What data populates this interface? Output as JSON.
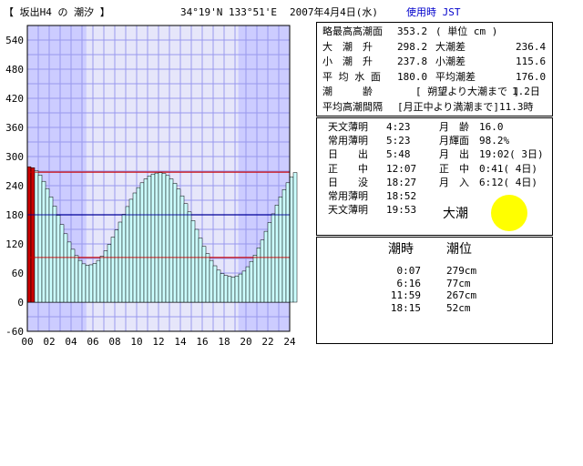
{
  "header": {
    "location": "【 坂出H4 の 潮汐 】",
    "coords": "34°19'N  133°51'E",
    "date": "2007年4月4日(水)",
    "timezone": "使用時 JST"
  },
  "info": {
    "rows": [
      [
        "略最高高潮面",
        "353.2",
        "( 単位 cm )",
        ""
      ],
      [
        "大　潮　升",
        "298.2",
        "大潮差",
        "236.4"
      ],
      [
        "小　潮　升",
        "237.8",
        "小潮差",
        "115.6"
      ],
      [
        "平 均 水 面",
        "180.0",
        "平均潮差",
        "176.0"
      ],
      [
        "潮　　　齢",
        "[ 朔望より大潮まで ]",
        "",
        "1.2日"
      ],
      [
        "平均高潮間隔",
        "[月正中より満潮まで]",
        "",
        "11.3時"
      ]
    ]
  },
  "astro": {
    "left": [
      [
        "天文薄明",
        "4:23"
      ],
      [
        "常用薄明",
        "5:23"
      ],
      [
        "日　　出",
        "5:48"
      ],
      [
        "正　　中",
        "12:07"
      ],
      [
        "日　　没",
        "18:27"
      ],
      [
        "常用薄明",
        "18:52"
      ],
      [
        "天文薄明",
        "19:53"
      ]
    ],
    "right": [
      [
        "月　齢",
        "16.0"
      ],
      [
        "月輝面",
        "98.2%"
      ],
      [
        "月　出",
        "19:02( 3日)"
      ],
      [
        "正　中",
        "0:41( 4日)"
      ],
      [
        "月　入",
        "6:12( 4日)"
      ]
    ],
    "tide_type": "大潮"
  },
  "tides": {
    "header_time": "潮時",
    "header_level": "潮位",
    "events": [
      [
        "0:07",
        "279cm"
      ],
      [
        "6:16",
        "77cm"
      ],
      [
        "11:59",
        "267cm"
      ],
      [
        "18:15",
        "52cm"
      ]
    ]
  },
  "colors": {
    "plot_bg": "#e6e6fa",
    "night_band": "#ccccff",
    "bar_fill": "#ccffff",
    "current_bar": "#cc0000",
    "upper_line": "#cc0000",
    "mean_line": "#000099",
    "lower_line": "#cc0000",
    "moon": "#ffff00"
  },
  "chart_data": {
    "type": "bar",
    "xlim": [
      0,
      24
    ],
    "ylim": [
      -60,
      570
    ],
    "xticks": [
      "00",
      "02",
      "04",
      "06",
      "08",
      "10",
      "12",
      "14",
      "16",
      "18",
      "20",
      "22",
      "24"
    ],
    "yticks": [
      "-60",
      "0",
      "60",
      "120",
      "180",
      "240",
      "300",
      "360",
      "420",
      "480",
      "540"
    ],
    "ytick_values": [
      -60,
      0,
      60,
      120,
      180,
      240,
      300,
      360,
      420,
      480,
      540
    ],
    "night_periods": [
      [
        0,
        5.4
      ],
      [
        19.3,
        24
      ]
    ],
    "reference_lines": [
      {
        "value": 268,
        "color": "#cc0000"
      },
      {
        "value": 180,
        "color": "#000099"
      },
      {
        "value": 92,
        "color": "#cc0000"
      }
    ],
    "current_bars": [
      0,
      1
    ],
    "interval_minutes": 20,
    "values": [
      279,
      277,
      271,
      262,
      249,
      234,
      217,
      198,
      179,
      160,
      141,
      124,
      109,
      96,
      86,
      79,
      76,
      77,
      80,
      86,
      95,
      106,
      119,
      134,
      149,
      165,
      181,
      197,
      212,
      225,
      236,
      246,
      254,
      260,
      264,
      266,
      267,
      265,
      261,
      254,
      245,
      233,
      219,
      203,
      186,
      168,
      150,
      132,
      115,
      100,
      86,
      75,
      66,
      59,
      55,
      53,
      52,
      54,
      58,
      64,
      73,
      84,
      97,
      112,
      128,
      146,
      164,
      182,
      200,
      217,
      232,
      246,
      258,
      267
    ]
  }
}
